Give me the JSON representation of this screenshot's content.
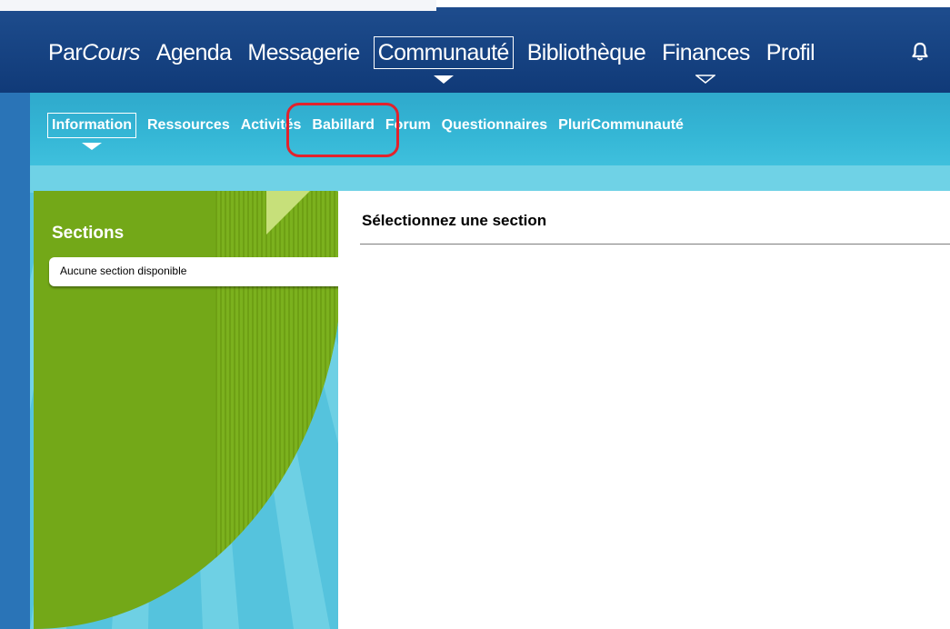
{
  "colors": {
    "top_nav_bg": "#133f7e",
    "sub_nav_bg": "#35b7d6",
    "sidebar_green": "#73a818",
    "highlight_red": "#e2222c"
  },
  "main_nav": {
    "brand_prefix": "Par",
    "brand_italic": "Cours",
    "items": [
      {
        "label": "Agenda"
      },
      {
        "label": "Messagerie"
      },
      {
        "label": "Communauté",
        "active": true
      },
      {
        "label": "Bibliothèque"
      },
      {
        "label": "Finances"
      },
      {
        "label": "Profil"
      }
    ],
    "notification_icon": "bell-icon"
  },
  "sub_nav": {
    "items": [
      {
        "label": "Information",
        "active": true
      },
      {
        "label": "Ressources"
      },
      {
        "label": "Activités",
        "highlighted": true
      },
      {
        "label": "Babillard"
      },
      {
        "label": "Forum"
      },
      {
        "label": "Questionnaires"
      },
      {
        "label": "PluriCommunauté"
      }
    ]
  },
  "sidebar": {
    "title": "Sections",
    "empty_text": "Aucune section disponible"
  },
  "main": {
    "title": "Sélectionnez une section"
  }
}
